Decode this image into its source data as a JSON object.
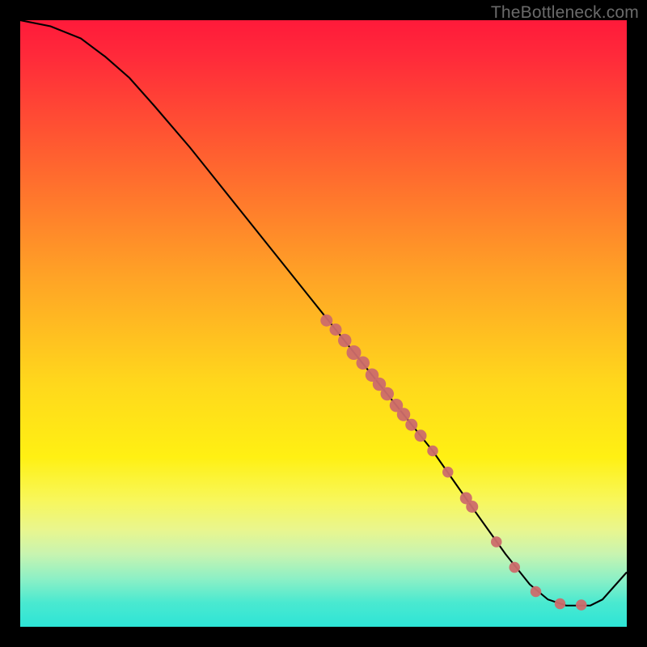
{
  "watermark": "TheBottleneck.com",
  "chart_data": {
    "type": "line",
    "title": "",
    "xlabel": "",
    "ylabel": "",
    "xlim": [
      0,
      100
    ],
    "ylim": [
      0,
      100
    ],
    "curve": [
      {
        "x": 0,
        "y": 100
      },
      {
        "x": 5,
        "y": 99
      },
      {
        "x": 10,
        "y": 97
      },
      {
        "x": 14,
        "y": 94
      },
      {
        "x": 18,
        "y": 90.5
      },
      {
        "x": 22,
        "y": 86
      },
      {
        "x": 28,
        "y": 79
      },
      {
        "x": 36,
        "y": 69
      },
      {
        "x": 44,
        "y": 59
      },
      {
        "x": 52,
        "y": 49
      },
      {
        "x": 60,
        "y": 39
      },
      {
        "x": 68,
        "y": 29
      },
      {
        "x": 75,
        "y": 19
      },
      {
        "x": 80,
        "y": 12
      },
      {
        "x": 84,
        "y": 7
      },
      {
        "x": 87,
        "y": 4.5
      },
      {
        "x": 90,
        "y": 3.5
      },
      {
        "x": 94,
        "y": 3.5
      },
      {
        "x": 96,
        "y": 4.5
      },
      {
        "x": 100,
        "y": 9
      }
    ],
    "markers": [
      {
        "x": 50.5,
        "y": 50.5,
        "r": 1.0
      },
      {
        "x": 52.0,
        "y": 49.0,
        "r": 1.0
      },
      {
        "x": 53.5,
        "y": 47.2,
        "r": 1.1
      },
      {
        "x": 55.0,
        "y": 45.2,
        "r": 1.2
      },
      {
        "x": 56.5,
        "y": 43.5,
        "r": 1.1
      },
      {
        "x": 58.0,
        "y": 41.5,
        "r": 1.1
      },
      {
        "x": 59.2,
        "y": 40.0,
        "r": 1.1
      },
      {
        "x": 60.5,
        "y": 38.4,
        "r": 1.1
      },
      {
        "x": 62.0,
        "y": 36.5,
        "r": 1.1
      },
      {
        "x": 63.2,
        "y": 35.0,
        "r": 1.1
      },
      {
        "x": 64.5,
        "y": 33.3,
        "r": 1.0
      },
      {
        "x": 66.0,
        "y": 31.5,
        "r": 1.0
      },
      {
        "x": 68.0,
        "y": 29.0,
        "r": 0.9
      },
      {
        "x": 70.5,
        "y": 25.5,
        "r": 0.9
      },
      {
        "x": 73.5,
        "y": 21.2,
        "r": 1.0
      },
      {
        "x": 74.5,
        "y": 19.8,
        "r": 1.0
      },
      {
        "x": 78.5,
        "y": 14.0,
        "r": 0.9
      },
      {
        "x": 81.5,
        "y": 9.8,
        "r": 0.9
      },
      {
        "x": 85.0,
        "y": 5.8,
        "r": 0.9
      },
      {
        "x": 89.0,
        "y": 3.8,
        "r": 0.9
      },
      {
        "x": 92.5,
        "y": 3.6,
        "r": 0.9
      }
    ]
  }
}
